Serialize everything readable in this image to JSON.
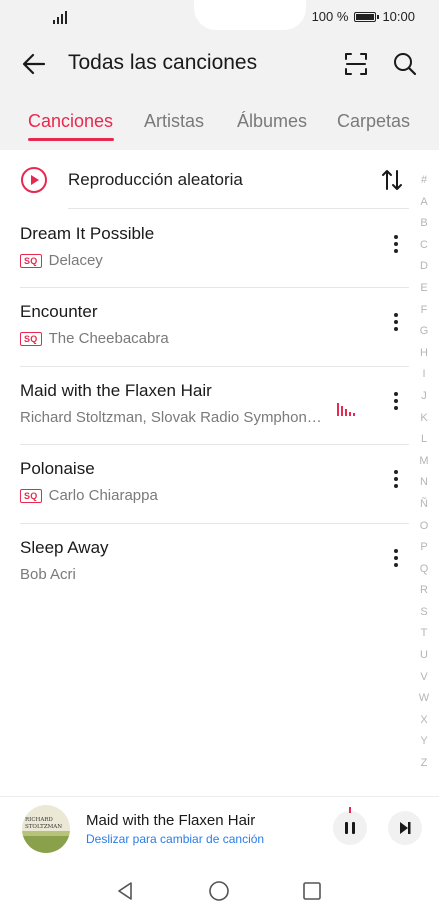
{
  "status_bar": {
    "battery_text": "100 %",
    "time": "10:00",
    "battery_level": 1.0
  },
  "header": {
    "title": "Todas las canciones",
    "back_icon": "back-arrow-icon",
    "scan_icon": "scan-icon",
    "search_icon": "search-icon"
  },
  "tabs": [
    {
      "label": "Canciones",
      "active": true
    },
    {
      "label": "Artistas",
      "active": false
    },
    {
      "label": "Álbumes",
      "active": false
    },
    {
      "label": "Carpetas",
      "active": false
    }
  ],
  "shuffle": {
    "label": "Reproducción aleatoria",
    "icon": "play-circle-icon",
    "sort_icon": "sort-icon"
  },
  "songs": [
    {
      "title": "Dream It Possible",
      "artist": "Delacey",
      "badge": "SQ"
    },
    {
      "title": "Encounter",
      "artist": "The Cheebacabra",
      "badge": "SQ"
    },
    {
      "title": "Maid with the Flaxen Hair",
      "artist": "Richard Stoltzman, Slovak Radio Symphon…",
      "badge": ""
    },
    {
      "title": "Polonaise",
      "artist": "Carlo Chiarappa",
      "badge": "SQ"
    },
    {
      "title": "Sleep Away",
      "artist": "Bob Acri",
      "badge": ""
    }
  ],
  "alpha_index": [
    "#",
    "A",
    "B",
    "C",
    "D",
    "E",
    "F",
    "G",
    "H",
    "I",
    "J",
    "K",
    "L",
    "M",
    "N",
    "Ñ",
    "O",
    "P",
    "Q",
    "R",
    "S",
    "T",
    "U",
    "V",
    "W",
    "X",
    "Y",
    "Z"
  ],
  "player": {
    "title": "Maid with the Flaxen Hair",
    "hint": "Deslizar para cambiar de canción",
    "pause_icon": "pause-icon",
    "next_icon": "next-track-icon",
    "cover_text_line1": "RICHARD",
    "cover_text_line2": "STOLTZMAN"
  },
  "nav_bar": {
    "back_icon": "nav-back-icon",
    "home_icon": "nav-home-icon",
    "recents_icon": "nav-recents-icon"
  },
  "colors": {
    "accent": "#e8294f",
    "link": "#2b7de9",
    "header_bg": "#f2f2f2"
  }
}
